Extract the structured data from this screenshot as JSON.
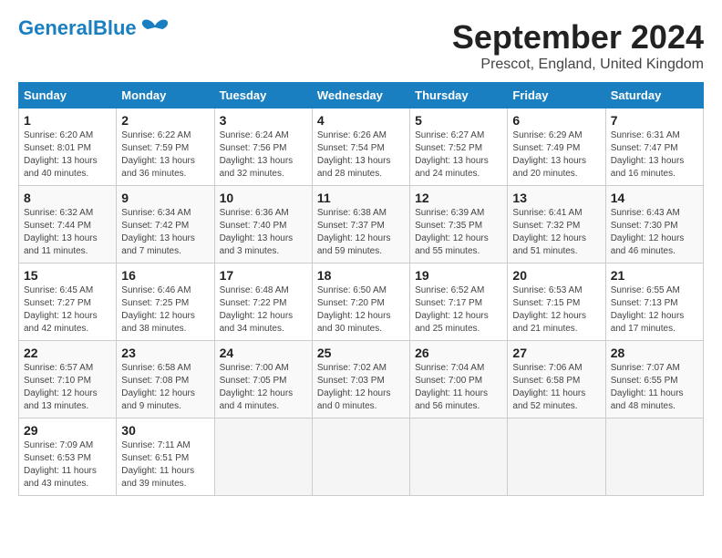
{
  "header": {
    "logo_general": "General",
    "logo_blue": "Blue",
    "title": "September 2024",
    "subtitle": "Prescot, England, United Kingdom"
  },
  "calendar": {
    "days_of_week": [
      "Sunday",
      "Monday",
      "Tuesday",
      "Wednesday",
      "Thursday",
      "Friday",
      "Saturday"
    ],
    "weeks": [
      [
        {
          "num": "1",
          "info": "Sunrise: 6:20 AM\nSunset: 8:01 PM\nDaylight: 13 hours\nand 40 minutes."
        },
        {
          "num": "2",
          "info": "Sunrise: 6:22 AM\nSunset: 7:59 PM\nDaylight: 13 hours\nand 36 minutes."
        },
        {
          "num": "3",
          "info": "Sunrise: 6:24 AM\nSunset: 7:56 PM\nDaylight: 13 hours\nand 32 minutes."
        },
        {
          "num": "4",
          "info": "Sunrise: 6:26 AM\nSunset: 7:54 PM\nDaylight: 13 hours\nand 28 minutes."
        },
        {
          "num": "5",
          "info": "Sunrise: 6:27 AM\nSunset: 7:52 PM\nDaylight: 13 hours\nand 24 minutes."
        },
        {
          "num": "6",
          "info": "Sunrise: 6:29 AM\nSunset: 7:49 PM\nDaylight: 13 hours\nand 20 minutes."
        },
        {
          "num": "7",
          "info": "Sunrise: 6:31 AM\nSunset: 7:47 PM\nDaylight: 13 hours\nand 16 minutes."
        }
      ],
      [
        {
          "num": "8",
          "info": "Sunrise: 6:32 AM\nSunset: 7:44 PM\nDaylight: 13 hours\nand 11 minutes."
        },
        {
          "num": "9",
          "info": "Sunrise: 6:34 AM\nSunset: 7:42 PM\nDaylight: 13 hours\nand 7 minutes."
        },
        {
          "num": "10",
          "info": "Sunrise: 6:36 AM\nSunset: 7:40 PM\nDaylight: 13 hours\nand 3 minutes."
        },
        {
          "num": "11",
          "info": "Sunrise: 6:38 AM\nSunset: 7:37 PM\nDaylight: 12 hours\nand 59 minutes."
        },
        {
          "num": "12",
          "info": "Sunrise: 6:39 AM\nSunset: 7:35 PM\nDaylight: 12 hours\nand 55 minutes."
        },
        {
          "num": "13",
          "info": "Sunrise: 6:41 AM\nSunset: 7:32 PM\nDaylight: 12 hours\nand 51 minutes."
        },
        {
          "num": "14",
          "info": "Sunrise: 6:43 AM\nSunset: 7:30 PM\nDaylight: 12 hours\nand 46 minutes."
        }
      ],
      [
        {
          "num": "15",
          "info": "Sunrise: 6:45 AM\nSunset: 7:27 PM\nDaylight: 12 hours\nand 42 minutes."
        },
        {
          "num": "16",
          "info": "Sunrise: 6:46 AM\nSunset: 7:25 PM\nDaylight: 12 hours\nand 38 minutes."
        },
        {
          "num": "17",
          "info": "Sunrise: 6:48 AM\nSunset: 7:22 PM\nDaylight: 12 hours\nand 34 minutes."
        },
        {
          "num": "18",
          "info": "Sunrise: 6:50 AM\nSunset: 7:20 PM\nDaylight: 12 hours\nand 30 minutes."
        },
        {
          "num": "19",
          "info": "Sunrise: 6:52 AM\nSunset: 7:17 PM\nDaylight: 12 hours\nand 25 minutes."
        },
        {
          "num": "20",
          "info": "Sunrise: 6:53 AM\nSunset: 7:15 PM\nDaylight: 12 hours\nand 21 minutes."
        },
        {
          "num": "21",
          "info": "Sunrise: 6:55 AM\nSunset: 7:13 PM\nDaylight: 12 hours\nand 17 minutes."
        }
      ],
      [
        {
          "num": "22",
          "info": "Sunrise: 6:57 AM\nSunset: 7:10 PM\nDaylight: 12 hours\nand 13 minutes."
        },
        {
          "num": "23",
          "info": "Sunrise: 6:58 AM\nSunset: 7:08 PM\nDaylight: 12 hours\nand 9 minutes."
        },
        {
          "num": "24",
          "info": "Sunrise: 7:00 AM\nSunset: 7:05 PM\nDaylight: 12 hours\nand 4 minutes."
        },
        {
          "num": "25",
          "info": "Sunrise: 7:02 AM\nSunset: 7:03 PM\nDaylight: 12 hours\nand 0 minutes."
        },
        {
          "num": "26",
          "info": "Sunrise: 7:04 AM\nSunset: 7:00 PM\nDaylight: 11 hours\nand 56 minutes."
        },
        {
          "num": "27",
          "info": "Sunrise: 7:06 AM\nSunset: 6:58 PM\nDaylight: 11 hours\nand 52 minutes."
        },
        {
          "num": "28",
          "info": "Sunrise: 7:07 AM\nSunset: 6:55 PM\nDaylight: 11 hours\nand 48 minutes."
        }
      ],
      [
        {
          "num": "29",
          "info": "Sunrise: 7:09 AM\nSunset: 6:53 PM\nDaylight: 11 hours\nand 43 minutes."
        },
        {
          "num": "30",
          "info": "Sunrise: 7:11 AM\nSunset: 6:51 PM\nDaylight: 11 hours\nand 39 minutes."
        },
        {
          "num": "",
          "info": ""
        },
        {
          "num": "",
          "info": ""
        },
        {
          "num": "",
          "info": ""
        },
        {
          "num": "",
          "info": ""
        },
        {
          "num": "",
          "info": ""
        }
      ]
    ]
  }
}
